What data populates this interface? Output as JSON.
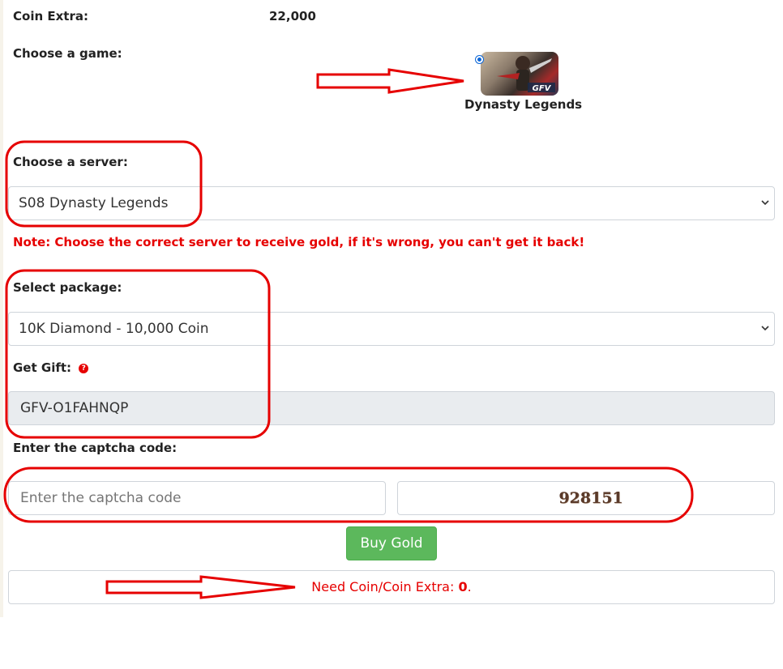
{
  "coin_extra": {
    "label": "Coin Extra:",
    "value": "22,000"
  },
  "game": {
    "label": "Choose a game:",
    "option_name": "Dynasty Legends",
    "thumb_badge": "GFV"
  },
  "server": {
    "label": "Choose a server:",
    "selected": "S08 Dynasty Legends"
  },
  "note": "Note: Choose the correct server to receive gold, if it's wrong, you can't get it back!",
  "package": {
    "label": "Select package:",
    "selected": "10K Diamond - 10,000 Coin"
  },
  "gift": {
    "label": "Get Gift:",
    "help_icon": "?",
    "value": "GFV-O1FAHNQP"
  },
  "captcha": {
    "label": "Enter the captcha code:",
    "placeholder": "Enter the captcha code",
    "code": "928151"
  },
  "buy_button": "Buy Gold",
  "need": {
    "prefix": "Need Coin/Coin Extra: ",
    "amount": "0",
    "suffix": "."
  },
  "colors": {
    "accent_red": "#e60000",
    "button_green": "#5cb85c",
    "radio_blue": "#0a66d8"
  },
  "icons": [
    "radio-selected-icon",
    "question-circle-icon",
    "chevron-down-icon",
    "arrow-right-icon"
  ]
}
